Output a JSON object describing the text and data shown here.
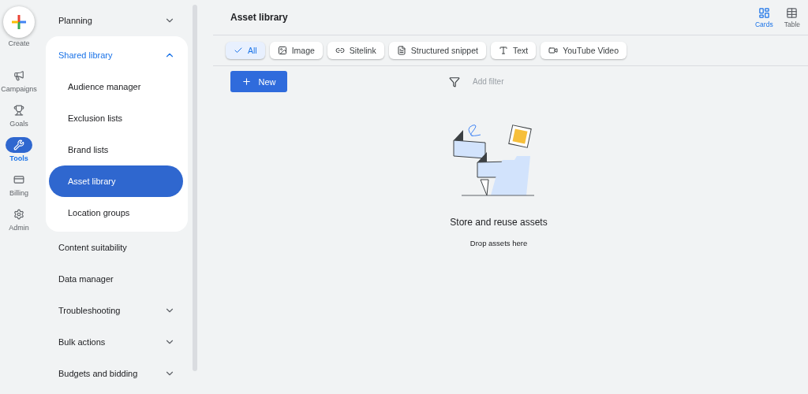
{
  "rail": [
    {
      "label": "Create",
      "kind": "create",
      "selected": false
    },
    {
      "label": "Campaigns",
      "kind": "nav",
      "selected": false
    },
    {
      "label": "Goals",
      "kind": "nav",
      "selected": false
    },
    {
      "label": "Tools",
      "kind": "nav",
      "selected": true
    },
    {
      "label": "Billing",
      "kind": "nav",
      "selected": false
    },
    {
      "label": "Admin",
      "kind": "nav",
      "selected": false
    }
  ],
  "nav": [
    {
      "label": "Planning",
      "expanded": false
    },
    {
      "label": "Shared library",
      "expanded": true,
      "children": [
        {
          "label": "Audience manager",
          "selected": false
        },
        {
          "label": "Exclusion lists",
          "selected": false
        },
        {
          "label": "Brand lists",
          "selected": false
        },
        {
          "label": "Asset library",
          "selected": true
        },
        {
          "label": "Location groups",
          "selected": false
        }
      ]
    },
    {
      "label": "Content suitability"
    },
    {
      "label": "Data manager"
    },
    {
      "label": "Troubleshooting",
      "expanded": false
    },
    {
      "label": "Bulk actions",
      "expanded": false
    },
    {
      "label": "Budgets and bidding",
      "expanded": false
    }
  ],
  "page_title": "Asset library",
  "views": [
    {
      "label": "Cards",
      "selected": true
    },
    {
      "label": "Table",
      "selected": false
    }
  ],
  "chips": [
    {
      "label": "All",
      "selected": true
    },
    {
      "label": "Image",
      "selected": false
    },
    {
      "label": "Sitelink",
      "selected": false
    },
    {
      "label": "Structured snippet",
      "selected": false
    },
    {
      "label": "Text",
      "selected": false
    },
    {
      "label": "YouTube Video",
      "selected": false
    }
  ],
  "new_button": "New",
  "filter": {
    "placeholder": "Add filter"
  },
  "empty": {
    "title": "Store and reuse assets",
    "subtitle": "Drop assets here"
  }
}
